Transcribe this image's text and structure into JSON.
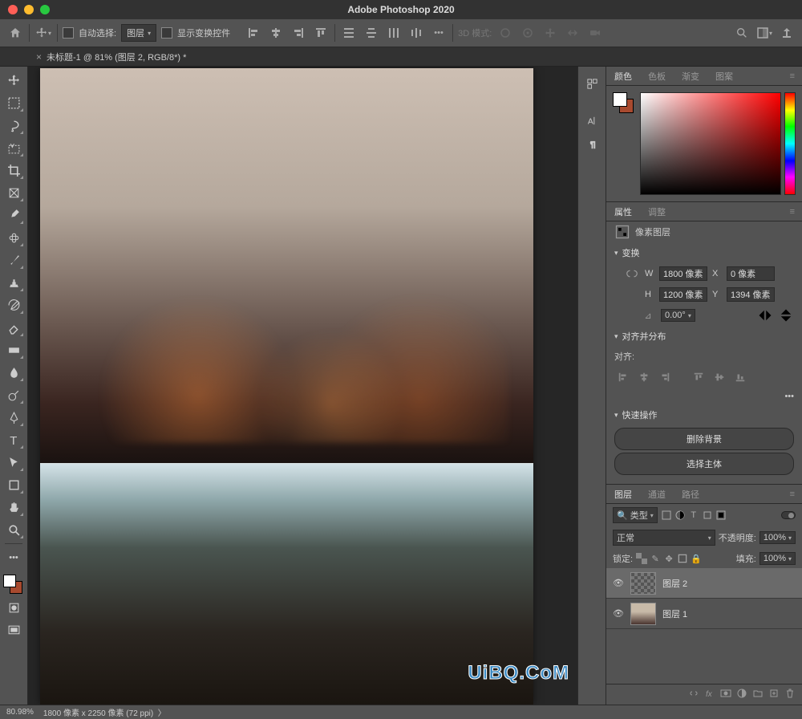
{
  "app_title": "Adobe Photoshop 2020",
  "doc_tab": "未标题-1 @ 81% (图层 2, RGB/8*) *",
  "options_bar": {
    "auto_select_label": "自动选择:",
    "auto_select_target": "图层",
    "show_transform_label": "显示变换控件",
    "mode_3d_label": "3D 模式:"
  },
  "panels": {
    "color": {
      "tab_color": "颜色",
      "tab_swatches": "色板",
      "tab_gradients": "渐变",
      "tab_patterns": "图案"
    },
    "properties": {
      "tab_properties": "属性",
      "tab_adjustments": "调整",
      "layer_type": "像素图层",
      "transform_title": "变换",
      "w_label": "W",
      "w_value": "1800 像素",
      "h_label": "H",
      "h_value": "1200 像素",
      "x_label": "X",
      "x_value": "0 像素",
      "y_label": "Y",
      "y_value": "1394 像素",
      "angle_value": "0.00°",
      "align_title": "对齐并分布",
      "align_label": "对齐:",
      "quick_actions_title": "快速操作",
      "remove_bg": "删除背景",
      "select_subject": "选择主体"
    },
    "layers": {
      "tab_layers": "图层",
      "tab_channels": "通道",
      "tab_paths": "路径",
      "filter_kind": "类型",
      "blend_mode": "正常",
      "opacity_label": "不透明度:",
      "opacity_value": "100%",
      "lock_label": "锁定:",
      "fill_label": "填充:",
      "fill_value": "100%",
      "items": [
        {
          "name": "图层 2"
        },
        {
          "name": "图层 1"
        }
      ]
    }
  },
  "status": {
    "zoom": "80.98%",
    "doc_info": "1800 像素 x 2250 像素 (72 ppi)"
  },
  "watermark": "UiBQ.CoM"
}
